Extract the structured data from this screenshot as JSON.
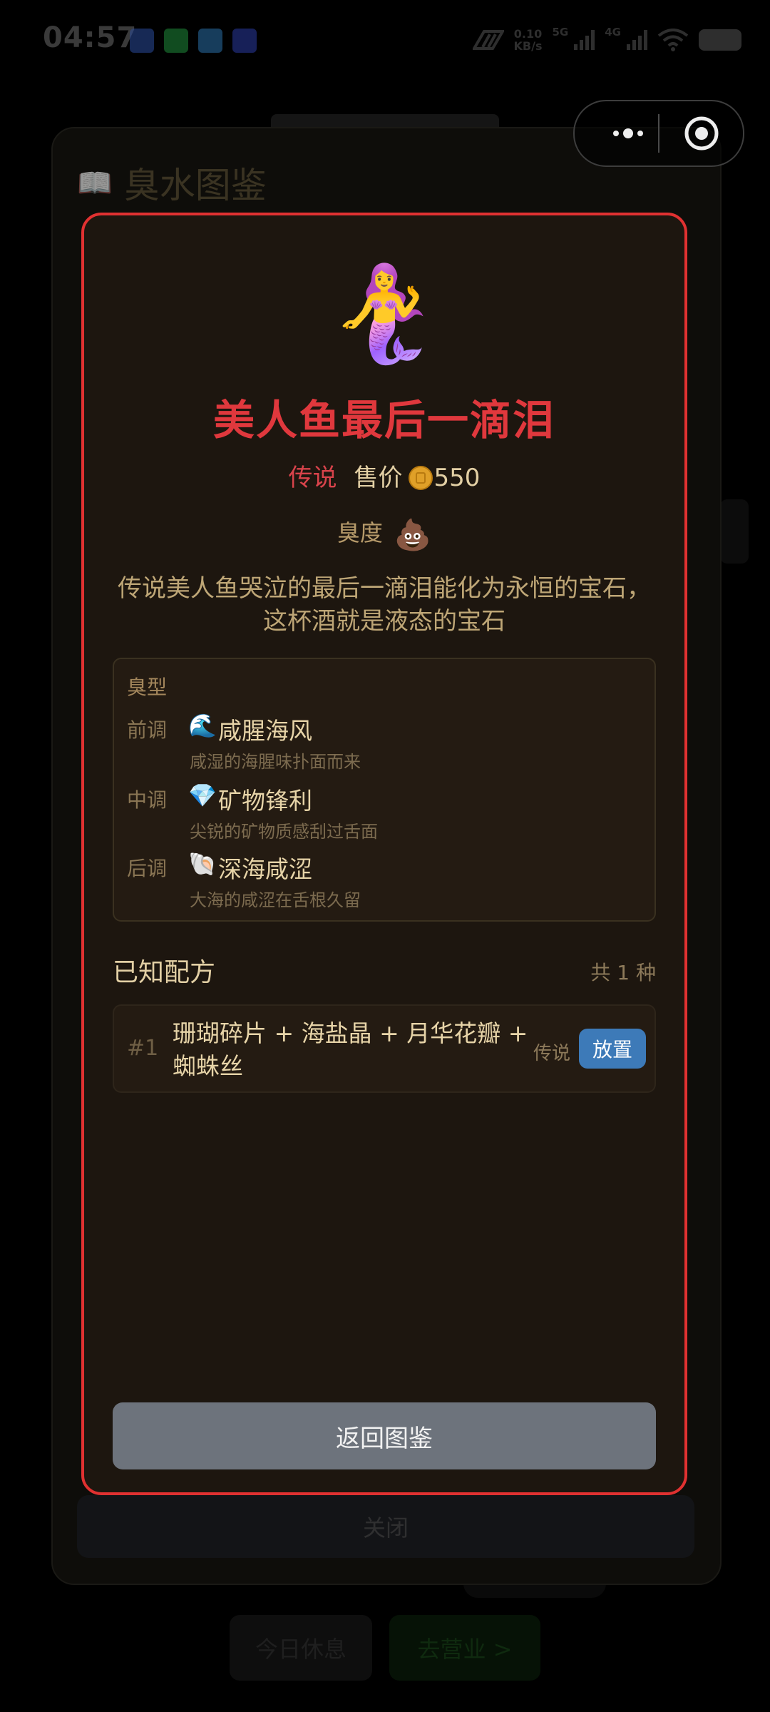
{
  "status_bar": {
    "time": "04:57",
    "net_speed_value": "0.10",
    "net_speed_unit": "KB/s",
    "sim1": "5G",
    "sim2": "4G"
  },
  "background": {
    "album_title": "臭水图鉴",
    "album_close": "关闭",
    "rest_button": "今日休息",
    "go_button": "去营业 >"
  },
  "detail": {
    "emoji": "🧜‍♀️",
    "name": "美人鱼最后一滴泪",
    "rarity": "传说",
    "price_label": "售价",
    "price": "550",
    "stink_label": "臭度",
    "stink_icon": "💩",
    "description_line1": "传说美人鱼哭泣的最后一滴泪能化为永恒的宝石，",
    "description_line2": "这杯酒就是液态的宝石",
    "profile": {
      "title": "臭型",
      "notes": [
        {
          "label": "前调",
          "emoji": "🌊",
          "name": "咸腥海风",
          "desc": "咸湿的海腥味扑面而来"
        },
        {
          "label": "中调",
          "emoji": "💎",
          "name": "矿物锋利",
          "desc": "尖锐的矿物质感刮过舌面"
        },
        {
          "label": "后调",
          "emoji": "🐚",
          "name": "深海咸涩",
          "desc": "大海的咸涩在舌根久留"
        }
      ]
    },
    "recipes_title": "已知配方",
    "recipes_count": "共 1 种",
    "recipes": [
      {
        "index": "#1",
        "ingredients_line1": "珊瑚碎片 + 海盐晶 + 月华花瓣 +",
        "ingredients_line2": "蜘蛛丝",
        "rarity": "传说",
        "action": "放置"
      }
    ],
    "back_button": "返回图鉴"
  }
}
